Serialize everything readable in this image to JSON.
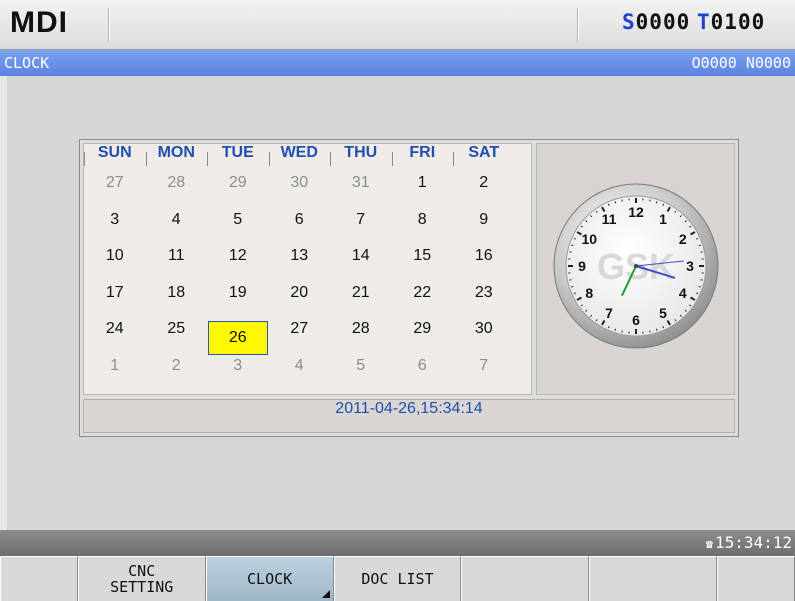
{
  "topbar": {
    "mode": "MDI",
    "spindle_letter": "S",
    "spindle_value": "0000",
    "tool_letter": "T",
    "tool_value": "0100"
  },
  "titlebar": {
    "screen": "CLOCK",
    "program": "O0000 N0000"
  },
  "calendar": {
    "day_names": [
      "SUN",
      "MON",
      "TUE",
      "WED",
      "THU",
      "FRI",
      "SAT"
    ],
    "weeks": [
      [
        {
          "d": "27",
          "dim": true
        },
        {
          "d": "28",
          "dim": true
        },
        {
          "d": "29",
          "dim": true
        },
        {
          "d": "30",
          "dim": true
        },
        {
          "d": "31",
          "dim": true
        },
        {
          "d": "1",
          "dim": false
        },
        {
          "d": "2",
          "dim": false
        }
      ],
      [
        {
          "d": "3",
          "dim": false
        },
        {
          "d": "4",
          "dim": false
        },
        {
          "d": "5",
          "dim": false
        },
        {
          "d": "6",
          "dim": false
        },
        {
          "d": "7",
          "dim": false
        },
        {
          "d": "8",
          "dim": false
        },
        {
          "d": "9",
          "dim": false
        }
      ],
      [
        {
          "d": "10",
          "dim": false
        },
        {
          "d": "11",
          "dim": false
        },
        {
          "d": "12",
          "dim": false
        },
        {
          "d": "13",
          "dim": false
        },
        {
          "d": "14",
          "dim": false
        },
        {
          "d": "15",
          "dim": false
        },
        {
          "d": "16",
          "dim": false
        }
      ],
      [
        {
          "d": "17",
          "dim": false
        },
        {
          "d": "18",
          "dim": false
        },
        {
          "d": "19",
          "dim": false
        },
        {
          "d": "20",
          "dim": false
        },
        {
          "d": "21",
          "dim": false
        },
        {
          "d": "22",
          "dim": false
        },
        {
          "d": "23",
          "dim": false
        }
      ],
      [
        {
          "d": "24",
          "dim": false
        },
        {
          "d": "25",
          "dim": false
        },
        {
          "d": "26",
          "dim": false,
          "today": true
        },
        {
          "d": "27",
          "dim": false
        },
        {
          "d": "28",
          "dim": false
        },
        {
          "d": "29",
          "dim": false
        },
        {
          "d": "30",
          "dim": false
        }
      ],
      [
        {
          "d": "1",
          "dim": true
        },
        {
          "d": "2",
          "dim": true
        },
        {
          "d": "3",
          "dim": true
        },
        {
          "d": "4",
          "dim": true
        },
        {
          "d": "5",
          "dim": true
        },
        {
          "d": "6",
          "dim": true
        },
        {
          "d": "7",
          "dim": true
        }
      ]
    ]
  },
  "clock": {
    "numerals": [
      "12",
      "1",
      "2",
      "3",
      "4",
      "5",
      "6",
      "7",
      "8",
      "9",
      "10",
      "11"
    ],
    "watermark": "GSK",
    "hour": 15,
    "minute": 34,
    "second": 14
  },
  "datetime": "2011-04-26,15:34:14",
  "statusbar": {
    "icon": "connection-icon",
    "time": "15:34:12"
  },
  "softkeys": [
    {
      "label": "",
      "size": "narrow",
      "active": false
    },
    {
      "label": "CNC\nSETTING",
      "size": "wide",
      "active": false
    },
    {
      "label": "CLOCK",
      "size": "wide",
      "active": true,
      "corner": true
    },
    {
      "label": "DOC LIST",
      "size": "wide",
      "active": false
    },
    {
      "label": "",
      "size": "wide",
      "active": false
    },
    {
      "label": "",
      "size": "wide",
      "active": false
    },
    {
      "label": "",
      "size": "narrow",
      "active": false
    }
  ],
  "colors": {
    "title_bar": "#6b8fe8",
    "accent_blue": "#1e4eb0",
    "today_highlight": "#fff800"
  }
}
